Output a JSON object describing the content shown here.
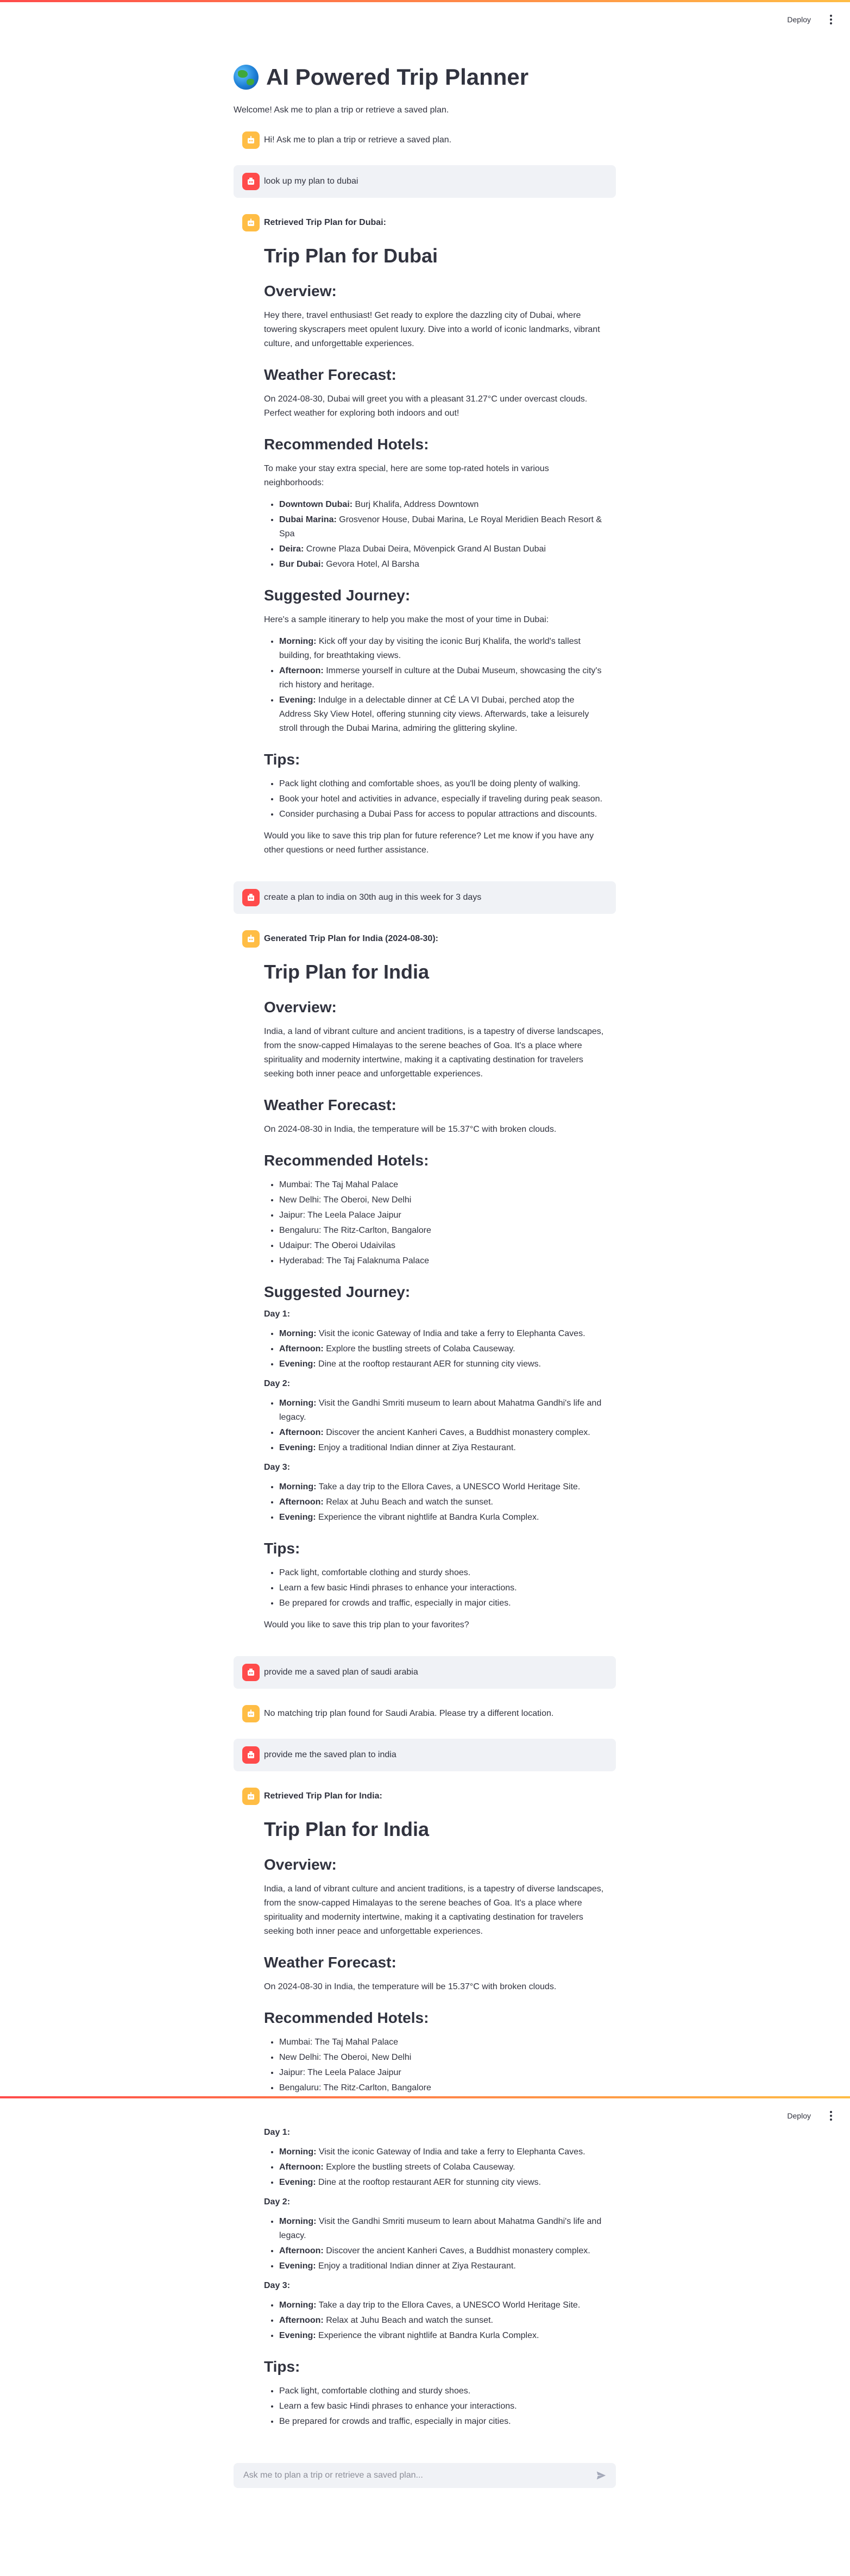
{
  "header": {
    "deploy_label": "Deploy"
  },
  "app": {
    "title": "AI Powered Trip Planner",
    "welcome": "Welcome! Ask me to plan a trip or retrieve a saved plan."
  },
  "messages": {
    "m1": "Hi! Ask me to plan a trip or retrieve a saved plan.",
    "m2": "look up my plan to dubai",
    "m3_heading": "Retrieved Trip Plan for Dubai:",
    "m4": "create a plan to india on 30th aug in this week for 3 days",
    "m5_heading": "Generated Trip Plan for India (2024-08-30):",
    "m6": "provide me a saved plan of saudi arabia",
    "m7": "No matching trip plan found for Saudi Arabia. Please try a different location.",
    "m8": "provide me the saved plan to india",
    "m9_heading": "Retrieved Trip Plan for India:"
  },
  "dubai": {
    "title": "Trip Plan for Dubai",
    "overview_h": "Overview:",
    "overview": "Hey there, travel enthusiast! Get ready to explore the dazzling city of Dubai, where towering skyscrapers meet opulent luxury. Dive into a world of iconic landmarks, vibrant culture, and unforgettable experiences.",
    "weather_h": "Weather Forecast:",
    "weather": "On 2024-08-30, Dubai will greet you with a pleasant 31.27°C under overcast clouds. Perfect weather for exploring both indoors and out!",
    "hotels_h": "Recommended Hotels:",
    "hotels_intro": "To make your stay extra special, here are some top-rated hotels in various neighborhoods:",
    "hotels": [
      {
        "area": "Downtown Dubai:",
        "names": " Burj Khalifa, Address Downtown"
      },
      {
        "area": "Dubai Marina:",
        "names": " Grosvenor House, Dubai Marina, Le Royal Meridien Beach Resort & Spa"
      },
      {
        "area": "Deira:",
        "names": " Crowne Plaza Dubai Deira, Mövenpick Grand Al Bustan Dubai"
      },
      {
        "area": "Bur Dubai:",
        "names": " Gevora Hotel, Al Barsha"
      }
    ],
    "journey_h": "Suggested Journey:",
    "journey_intro": "Here's a sample itinerary to help you make the most of your time in Dubai:",
    "journey": [
      {
        "time": "Morning:",
        "text": " Kick off your day by visiting the iconic Burj Khalifa, the world's tallest building, for breathtaking views."
      },
      {
        "time": "Afternoon:",
        "text": " Immerse yourself in culture at the Dubai Museum, showcasing the city's rich history and heritage."
      },
      {
        "time": "Evening:",
        "text": " Indulge in a delectable dinner at CÉ LA VI Dubai, perched atop the Address Sky View Hotel, offering stunning city views. Afterwards, take a leisurely stroll through the Dubai Marina, admiring the glittering skyline."
      }
    ],
    "tips_h": "Tips:",
    "tips": [
      "Pack light clothing and comfortable shoes, as you'll be doing plenty of walking.",
      "Book your hotel and activities in advance, especially if traveling during peak season.",
      "Consider purchasing a Dubai Pass for access to popular attractions and discounts."
    ],
    "closing": "Would you like to save this trip plan for future reference? Let me know if you have any other questions or need further assistance."
  },
  "india": {
    "title": "Trip Plan for India",
    "overview_h": "Overview:",
    "overview": "India, a land of vibrant culture and ancient traditions, is a tapestry of diverse landscapes, from the snow-capped Himalayas to the serene beaches of Goa. It's a place where spirituality and modernity intertwine, making it a captivating destination for travelers seeking both inner peace and unforgettable experiences.",
    "weather_h": "Weather Forecast:",
    "weather": "On 2024-08-30 in India, the temperature will be 15.37°C with broken clouds.",
    "hotels_h": "Recommended Hotels:",
    "hotels": [
      "Mumbai: The Taj Mahal Palace",
      "New Delhi: The Oberoi, New Delhi",
      "Jaipur: The Leela Palace Jaipur",
      "Bengaluru: The Ritz-Carlton, Bangalore",
      "Udaipur: The Oberoi Udaivilas",
      "Hyderabad: The Taj Falaknuma Palace"
    ],
    "journey_h": "Suggested Journey:",
    "days": [
      {
        "label": "Day 1:",
        "items": [
          {
            "time": "Morning:",
            "text": " Visit the iconic Gateway of India and take a ferry to Elephanta Caves."
          },
          {
            "time": "Afternoon:",
            "text": " Explore the bustling streets of Colaba Causeway."
          },
          {
            "time": "Evening:",
            "text": " Dine at the rooftop restaurant AER for stunning city views."
          }
        ]
      },
      {
        "label": "Day 2:",
        "items": [
          {
            "time": "Morning:",
            "text": " Visit the Gandhi Smriti museum to learn about Mahatma Gandhi's life and legacy."
          },
          {
            "time": "Afternoon:",
            "text": " Discover the ancient Kanheri Caves, a Buddhist monastery complex."
          },
          {
            "time": "Evening:",
            "text": " Enjoy a traditional Indian dinner at Ziya Restaurant."
          }
        ]
      },
      {
        "label": "Day 3:",
        "items": [
          {
            "time": "Morning:",
            "text": " Take a day trip to the Ellora Caves, a UNESCO World Heritage Site."
          },
          {
            "time": "Afternoon:",
            "text": " Relax at Juhu Beach and watch the sunset."
          },
          {
            "time": "Evening:",
            "text": " Experience the vibrant nightlife at Bandra Kurla Complex."
          }
        ]
      }
    ],
    "tips_h": "Tips:",
    "tips": [
      "Pack light, comfortable clothing and sturdy shoes.",
      "Learn a few basic Hindi phrases to enhance your interactions.",
      "Be prepared for crowds and traffic, especially in major cities."
    ],
    "closing": "Would you like to save this trip plan to your favorites?"
  },
  "chat_input": {
    "placeholder": "Ask me to plan a trip or retrieve a saved plan..."
  },
  "colors": {
    "bot_avatar": "#ffbd45",
    "user_avatar": "#ff4b4b",
    "user_bubble": "#f0f2f6",
    "text": "#31333f"
  },
  "icons": {
    "bot_avatar": "robot-icon",
    "user_avatar": "person-icon",
    "title_emoji": "globe-icon",
    "send": "send-icon",
    "menu": "kebab-menu-icon"
  }
}
